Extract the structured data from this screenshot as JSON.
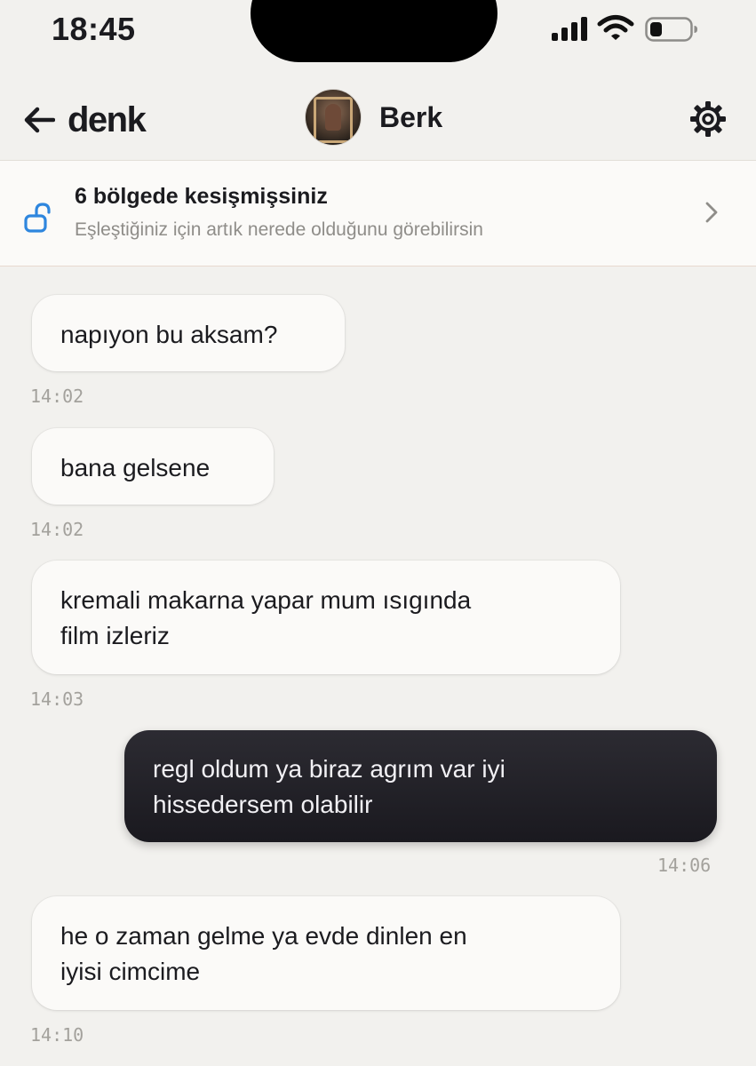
{
  "status_bar": {
    "time": "18:45"
  },
  "header": {
    "back_icon": "arrow-left-icon",
    "brand": "denk",
    "contact_name": "Berk",
    "settings_icon": "gear-icon"
  },
  "banner": {
    "icon": "unlock-icon",
    "title": "6 bölgede kesişmişsiniz",
    "subtitle": "Eşleştiğiniz için artık nerede olduğunu görebilirsin",
    "accent_color": "#2e86de"
  },
  "messages": [
    {
      "direction": "incoming",
      "lines": [
        "napıyon bu aksam?"
      ],
      "time": "14:02"
    },
    {
      "direction": "incoming",
      "lines": [
        "bana gelsene"
      ],
      "time": "14:02"
    },
    {
      "direction": "incoming",
      "lines": [
        "kremali makarna yapar mum ısıgında",
        "film izleriz"
      ],
      "time": "14:03"
    },
    {
      "direction": "outgoing",
      "lines": [
        "regl oldum ya biraz agrım var iyi",
        "hissedersem olabilir"
      ],
      "time": "14:06"
    },
    {
      "direction": "incoming",
      "lines": [
        "he o zaman gelme ya evde dinlen en",
        "iyisi cimcime"
      ],
      "time": "14:10"
    }
  ],
  "colors": {
    "background": "#f2f1ee",
    "incoming_bubble": "#fbfaf8",
    "outgoing_bubble": "#1f1e24"
  }
}
